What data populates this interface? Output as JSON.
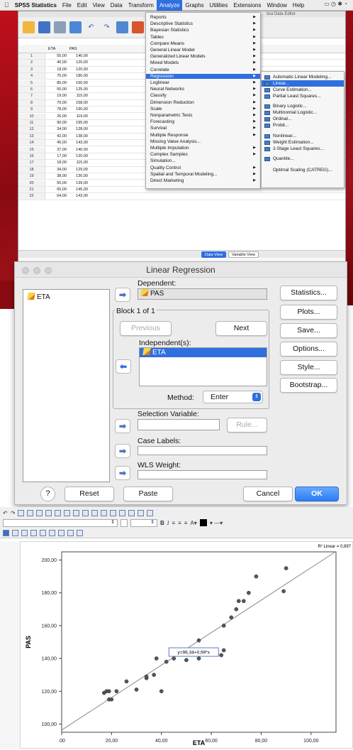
{
  "menubar": {
    "app": "SPSS Statistics",
    "items": [
      "File",
      "Edit",
      "View",
      "Data",
      "Transform",
      "Analyze",
      "Graphs",
      "Utilities",
      "Extensions",
      "Window",
      "Help"
    ],
    "active": "Analyze"
  },
  "editor": {
    "title_fragment": "tica Data Editor",
    "columns": [
      "ETA",
      "PAS"
    ],
    "rows": [
      [
        "1",
        "55,00",
        "140,00"
      ],
      [
        "2",
        "40,00",
        "120,00"
      ],
      [
        "3",
        "18,00",
        "120,00"
      ],
      [
        "4",
        "75,00",
        "180,00"
      ],
      [
        "5",
        "85,00",
        "160,00"
      ],
      [
        "6",
        "55,00",
        "125,00"
      ],
      [
        "7",
        "19,00",
        "115,00"
      ],
      [
        "8",
        "70,00",
        "158,00"
      ],
      [
        "9",
        "78,00",
        "190,00"
      ],
      [
        "10",
        "26,00",
        "119,00"
      ],
      [
        "11",
        "90,00",
        "195,00"
      ],
      [
        "12",
        "34,00",
        "128,00"
      ],
      [
        "13",
        "42,00",
        "138,00"
      ],
      [
        "14",
        "45,00",
        "143,00"
      ],
      [
        "15",
        "37,00",
        "140,00"
      ],
      [
        "16",
        "17,00",
        "120,00"
      ],
      [
        "17",
        "18,00",
        "115,00"
      ],
      [
        "18",
        "34,00",
        "129,00"
      ],
      [
        "19",
        "38,00",
        "130,00"
      ],
      [
        "20",
        "50,00",
        "139,00"
      ],
      [
        "21",
        "65,00",
        "145,00"
      ],
      [
        "22",
        "64,00",
        "143,00"
      ]
    ],
    "tab_data_view": "Data View",
    "tab_variable_view": "Variable View"
  },
  "analyze_menu": {
    "items": [
      "Reports",
      "Descriptive Statistics",
      "Bayesian Statistics",
      "Tables",
      "Compare Means",
      "General Linear Model",
      "Generalized Linear Models",
      "Mixed Models",
      "Correlate",
      "Regression",
      "Loglinear",
      "Neural Networks",
      "Classify",
      "Dimension Reduction",
      "Scale",
      "Nonparametric Tests",
      "Forecasting",
      "Survival",
      "Multiple Response",
      "Missing Value Analysis...",
      "Multiple Imputation",
      "Complex Samples",
      "Simulation...",
      "Quality Control",
      "Spatial and Temporal Modeling...",
      "Direct Marketing"
    ],
    "selected": "Regression"
  },
  "regression_submenu": {
    "items": [
      "Automatic Linear Modeling...",
      "Linear...",
      "Curve Estimation...",
      "Partial Least Squares...",
      "Binary Logistic...",
      "Multinomial Logistic...",
      "Ordinal...",
      "Probit...",
      "Nonlinear...",
      "Weight Estimation...",
      "2-Stage Least Squares...",
      "Quantile...",
      "Optimal Scaling (CATREG)..."
    ],
    "selected": "Linear..."
  },
  "dialog": {
    "title": "Linear Regression",
    "variables": [
      "ETA"
    ],
    "dependent_label": "Dependent:",
    "dependent_value": "PAS",
    "block_label": "Block 1 of 1",
    "previous": "Previous",
    "next": "Next",
    "independent_label": "Independent(s):",
    "independent_value": "ETA",
    "method_label": "Method:",
    "method_value": "Enter",
    "selection_label": "Selection Variable:",
    "rule": "Rule...",
    "case_labels": "Case Labels:",
    "wls_label": "WLS Weight:",
    "side_buttons": [
      "Statistics...",
      "Plots...",
      "Save...",
      "Options...",
      "Style...",
      "Bootstrap..."
    ],
    "help": "?",
    "reset": "Reset",
    "paste": "Paste",
    "cancel": "Cancel",
    "ok": "OK"
  },
  "chart_editor": {
    "font_size_dropdown": "",
    "bold": "B",
    "italic": "I"
  },
  "chart_data": {
    "type": "scatter",
    "xlabel": "ETA",
    "ylabel": "PAS",
    "xlim": [
      0,
      110
    ],
    "ylim": [
      95,
      205
    ],
    "xticks": [
      ".00",
      "20,00",
      "40,00",
      "60,00",
      "80,00",
      "100,00"
    ],
    "xtick_values": [
      0,
      20,
      40,
      60,
      80,
      100
    ],
    "yticks": [
      "100,00",
      "120,00",
      "140,00",
      "160,00",
      "180,00",
      "200,00"
    ],
    "ytick_values": [
      100,
      120,
      140,
      160,
      180,
      200
    ],
    "points": [
      [
        17,
        119
      ],
      [
        18,
        120
      ],
      [
        19,
        120
      ],
      [
        19,
        115
      ],
      [
        20,
        115
      ],
      [
        22,
        120
      ],
      [
        26,
        126
      ],
      [
        30,
        121
      ],
      [
        34,
        128
      ],
      [
        34,
        129
      ],
      [
        37,
        130
      ],
      [
        38,
        140
      ],
      [
        40,
        120
      ],
      [
        42,
        138
      ],
      [
        45,
        140
      ],
      [
        50,
        139
      ],
      [
        55,
        140
      ],
      [
        55,
        151
      ],
      [
        64,
        142
      ],
      [
        65,
        145
      ],
      [
        65,
        160
      ],
      [
        68,
        165
      ],
      [
        70,
        170
      ],
      [
        71,
        175
      ],
      [
        73,
        175
      ],
      [
        75,
        180
      ],
      [
        78,
        190
      ],
      [
        89,
        181
      ],
      [
        90,
        195
      ]
    ],
    "fit": {
      "intercept": 96.34,
      "slope": 0.99
    },
    "equation_label": "y=96,34+0,99*x",
    "r2_label": "R² Linear = 0,897",
    "grid": false
  },
  "colors": {
    "accent": "#2f6fde",
    "brand_red": "#c3101c"
  }
}
